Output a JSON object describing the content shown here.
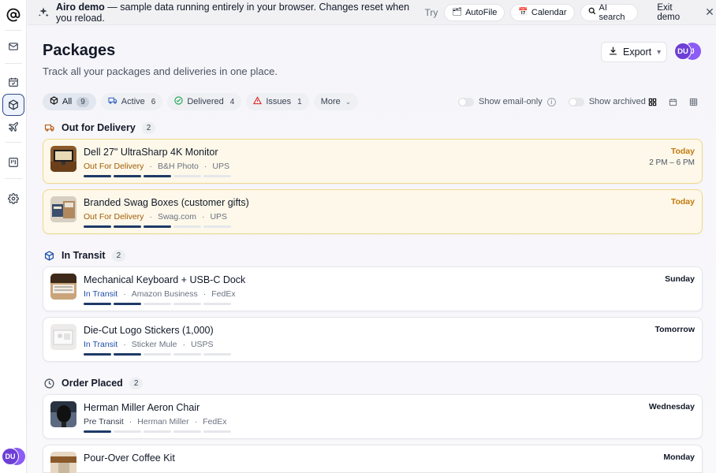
{
  "banner": {
    "brand": "Airo demo",
    "message": " — sample data running entirely in your browser. Changes reset when you reload.",
    "try_label": "Try",
    "chips": [
      {
        "label": "AutoFile",
        "icon": "folder-icon"
      },
      {
        "label": "Calendar",
        "icon": "calendar-icon"
      },
      {
        "label": "AI search",
        "icon": "search-icon"
      }
    ],
    "exit_label": "Exit demo"
  },
  "rail": {
    "items": [
      "at-sign-icon",
      "mail-icon",
      "calendar-check-icon",
      "package-icon",
      "plane-icon",
      "kanban-icon",
      "gear-icon"
    ],
    "active": "package-icon",
    "avatar_initials": "DU"
  },
  "header": {
    "title": "Packages",
    "subtitle": "Track all your packages and deliveries in one place.",
    "export_label": "Export",
    "avatar_initials": "DU",
    "avatar_initials_2": "J"
  },
  "filters": {
    "tabs": [
      {
        "label": "All",
        "count": "9",
        "icon": "package-icon",
        "active": true
      },
      {
        "label": "Active",
        "count": "6",
        "icon": "truck-icon"
      },
      {
        "label": "Delivered",
        "count": "4",
        "icon": "check-circle-icon"
      },
      {
        "label": "Issues",
        "count": "1",
        "icon": "warning-icon"
      }
    ],
    "more_label": "More",
    "toggle_email": "Show email-only",
    "toggle_archived": "Show archived"
  },
  "sections": [
    {
      "title": "Out for Delivery",
      "count": "2",
      "icon": "truck-icon"
    },
    {
      "title": "In Transit",
      "count": "2",
      "icon": "package-icon"
    },
    {
      "title": "Order Placed",
      "count": "2",
      "icon": "clock-icon"
    }
  ],
  "packages": [
    {
      "name": "Dell 27\" UltraSharp 4K Monitor",
      "status": "Out For Delivery",
      "merchant": "B&H Photo",
      "carrier": "UPS",
      "when": "Today",
      "window": "2 PM – 6 PM",
      "progress": 3,
      "steps": 5
    },
    {
      "name": "Branded Swag Boxes (customer gifts)",
      "status": "Out For Delivery",
      "merchant": "Swag.com",
      "carrier": "UPS",
      "when": "Today",
      "window": "",
      "progress": 3,
      "steps": 5
    },
    {
      "name": "Mechanical Keyboard + USB-C Dock",
      "status": "In Transit",
      "merchant": "Amazon Business",
      "carrier": "FedEx",
      "when": "Sunday",
      "window": "",
      "progress": 2,
      "steps": 5
    },
    {
      "name": "Die-Cut Logo Stickers (1,000)",
      "status": "In Transit",
      "merchant": "Sticker Mule",
      "carrier": "USPS",
      "when": "Tomorrow",
      "window": "",
      "progress": 2,
      "steps": 5
    },
    {
      "name": "Herman Miller Aeron Chair",
      "status": "Pre Transit",
      "merchant": "Herman Miller",
      "carrier": "FedEx",
      "when": "Wednesday",
      "window": "",
      "progress": 1,
      "steps": 5
    },
    {
      "name": "Pour-Over Coffee Kit",
      "status": "",
      "merchant": "",
      "carrier": "",
      "when": "Monday",
      "window": "",
      "progress": 0,
      "steps": 5
    }
  ],
  "colors": {
    "accent": "#1f3a68",
    "today": "#c27a0e",
    "ofd_status": "#a15c07",
    "transit_status": "#1e4fa8",
    "ofd_card_bg": "#fdf8e9",
    "ofd_card_border": "#f0d98c",
    "avatar": "#6d3fd6"
  }
}
